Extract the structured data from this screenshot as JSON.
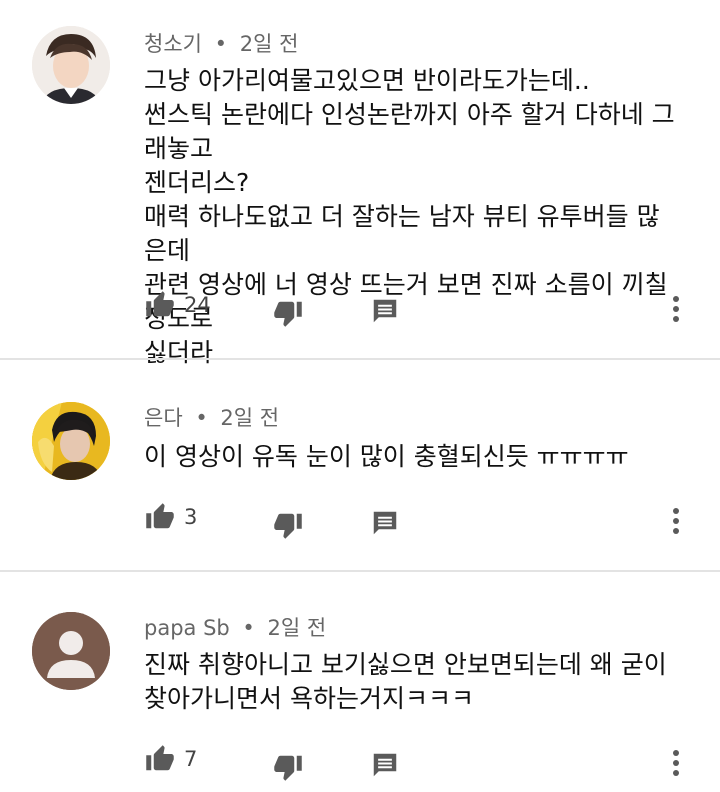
{
  "comments": [
    {
      "author": "청소기",
      "time": "2일 전",
      "text": "그냥 아가리여물고있으면 반이라도가는데..\n썬스틱 논란에다 인성논란까지 아주 할거 다하네  그래놓고\n젠더리스?\n매력 하나도없고 더 잘하는 남자 뷰티 유투버들 많은데\n관련 영상에 너 영상 뜨는거 보면 진짜 소름이 끼칠 정도로\n싫더라",
      "likes": "24"
    },
    {
      "author": "은다",
      "time": "2일 전",
      "text": "이 영상이 유독 눈이 많이 충혈되신듯 ㅠㅠㅠㅠ",
      "likes": "3"
    },
    {
      "author": "papa Sb",
      "time": "2일 전",
      "text": "진짜 취향아니고 보기싫으면 안보면되는데 왜 굳이\n찾아가니면서 욕하는거지ㅋㅋㅋ",
      "likes": "7"
    }
  ],
  "separator": "•",
  "icons": [
    "like-icon",
    "dislike-icon",
    "reply-icon",
    "more-vert-icon"
  ],
  "colors": {
    "icon": "#5a5a5a",
    "divider": "#e3e3e3",
    "meta": "#666666"
  }
}
